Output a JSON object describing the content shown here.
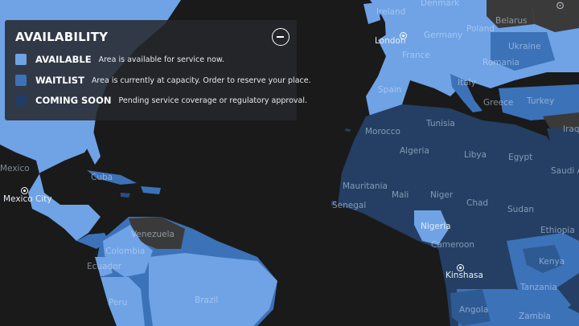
{
  "legend": {
    "title": "AVAILABILITY",
    "items": [
      {
        "key": "AVAILABLE",
        "description": "Area is available for service now.",
        "color": "#6fa3e6"
      },
      {
        "key": "WAITLIST",
        "description": "Area is currently at capacity. Order to reserve your place.",
        "color": "#3c72b8"
      },
      {
        "key": "COMING SOON",
        "description": "Pending service coverage or regulatory approval.",
        "color": "#1f3d66"
      }
    ],
    "collapse_icon": "minus-circle-icon"
  },
  "colors": {
    "ocean": "#1a1a1a",
    "available": "#6fa3e6",
    "waitlist": "#3c72b8",
    "coming_soon": "#243f63",
    "unavailable": "#3a3a3a"
  },
  "cities": [
    {
      "name": "London"
    },
    {
      "name": "Mexico City"
    },
    {
      "name": "Kinshasa"
    }
  ],
  "labels": {
    "ireland": "Ireland",
    "denmark": "Denmark",
    "belarus": "Belarus",
    "germany": "Germany",
    "poland": "Poland",
    "ukraine": "Ukraine",
    "france": "France",
    "romania": "Romania",
    "spain": "Spain",
    "italy": "Italy",
    "greece": "Greece",
    "turkey": "Turkey",
    "iraq": "Iraq",
    "morocco": "Morocco",
    "tunisia": "Tunisia",
    "algeria": "Algeria",
    "libya": "Libya",
    "egypt": "Egypt",
    "saudi": "Saudi A",
    "mauritania": "Mauritania",
    "mali": "Mali",
    "niger": "Niger",
    "chad": "Chad",
    "sudan": "Sudan",
    "senegal": "Senegal",
    "nigeria": "Nigeria",
    "ethiopia": "Ethiopia",
    "cameroon": "Cameroon",
    "kenya": "Kenya",
    "tanzania": "Tanzania",
    "angola": "Angola",
    "zambia": "Zambia",
    "mexico": "Mexico",
    "cuba": "Cuba",
    "venezuela": "Venezuela",
    "colombia": "Colombia",
    "ecuador": "Ecuador",
    "peru": "Peru",
    "brazil": "Brazil"
  }
}
